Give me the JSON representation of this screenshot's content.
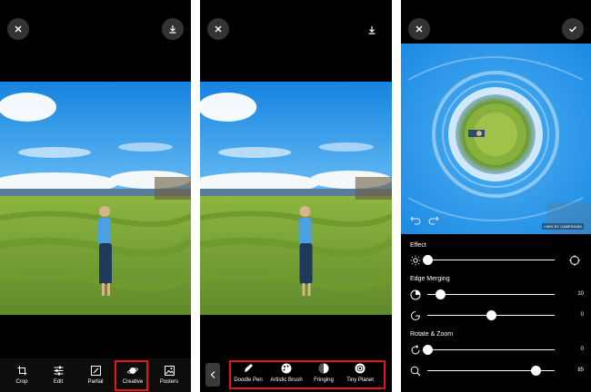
{
  "panel1": {
    "close_icon": "close-icon",
    "download_icon": "download-icon",
    "toolbar": [
      {
        "label": "Crop",
        "icon": "crop-icon"
      },
      {
        "label": "Edit",
        "icon": "sliders-icon"
      },
      {
        "label": "Partial",
        "icon": "partial-brush-icon"
      },
      {
        "label": "Creative",
        "icon": "planet-icon",
        "selected": true
      },
      {
        "label": "Posters",
        "icon": "poster-icon"
      }
    ]
  },
  "panel2": {
    "close_icon": "close-icon",
    "download_icon": "download-icon",
    "back_icon": "chevron-left-icon",
    "tools": [
      {
        "label": "Doodle Pen",
        "icon": "doodle-pen-icon"
      },
      {
        "label": "Artistic Brush",
        "icon": "palette-icon"
      },
      {
        "label": "Fringing",
        "icon": "fringing-icon"
      },
      {
        "label": "Tiny Planet",
        "icon": "tiny-planet-icon"
      }
    ]
  },
  "panel3": {
    "close_icon": "close-icon",
    "confirm_icon": "check-icon",
    "watermark": "• NEK BY CAMERA360",
    "sections": {
      "effect": "Effect",
      "edge_merging": "Edge Merging",
      "rotate_zoom": "Rotate & Zoom"
    },
    "sliders": [
      {
        "name": "effect",
        "value": "",
        "position": 0.0
      },
      {
        "name": "edge-merge",
        "value": "10",
        "position": 0.1
      },
      {
        "name": "edge-blend",
        "value": "0",
        "position": 0.5
      },
      {
        "name": "rotate",
        "value": "0",
        "position": 0.0
      },
      {
        "name": "zoom",
        "value": "85",
        "position": 0.85
      }
    ]
  },
  "colors": {
    "highlight": "#e8141b",
    "sky": "#1f8fe0",
    "field": "#7fa83a"
  }
}
